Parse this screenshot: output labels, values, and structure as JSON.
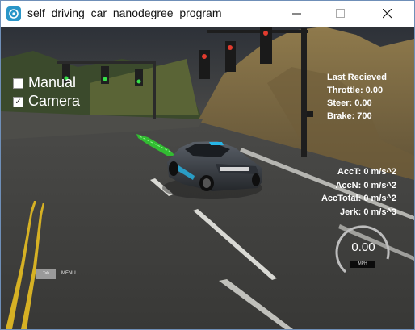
{
  "window": {
    "title": "self_driving_car_nanodegree_program"
  },
  "controls": {
    "manual_label": "Manual",
    "camera_label": "Camera",
    "manual_checked": false,
    "camera_checked": true
  },
  "telemetry": {
    "heading": "Last Recieved",
    "throttle": "Throttle: 0.00",
    "steer": "Steer: 0.00",
    "brake": "Brake: 700"
  },
  "acceleration": {
    "acc_t": "AccT: 0 m/s^2",
    "acc_n": "AccN: 0 m/s^2",
    "acc_total": "AccTotal: 0 m/s^2",
    "jerk": "Jerk: 0 m/s^3"
  },
  "speedometer": {
    "value": "0.00",
    "unit": "MPH"
  },
  "menu": {
    "button_label": "Tab",
    "label": "MENU"
  },
  "car": {
    "plate": "UDACITY"
  },
  "colors": {
    "path": "#2fd12f",
    "car_accent": "#27b5e6",
    "title_icon": "#2a96c8"
  }
}
